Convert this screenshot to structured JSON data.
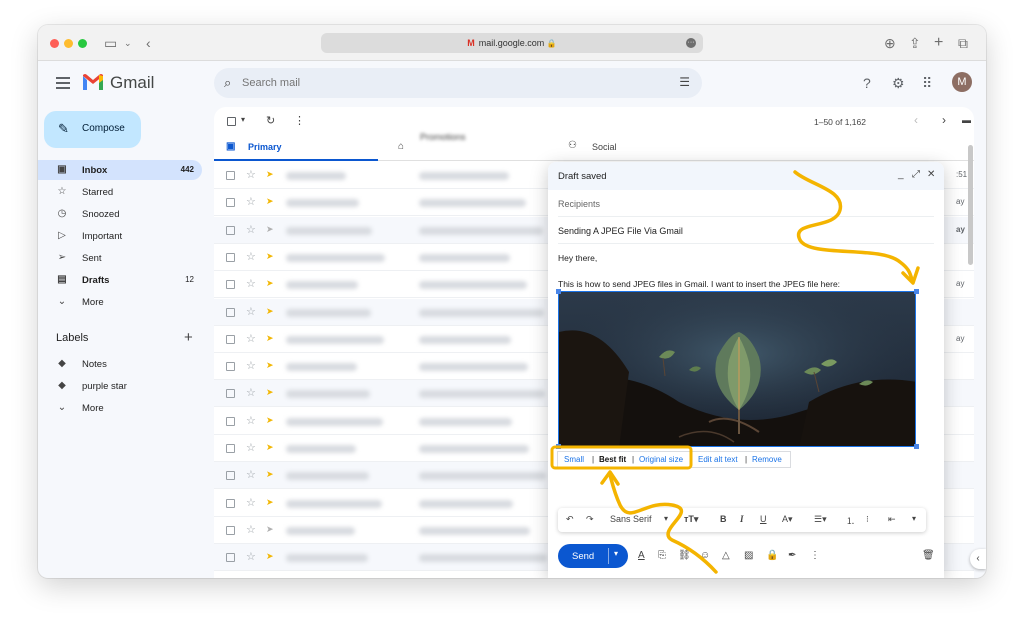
{
  "browser": {
    "url": "mail.google.com"
  },
  "gmail": {
    "brand": "Gmail",
    "search_placeholder": "Search mail",
    "avatar_letter": "M"
  },
  "sidebar": {
    "compose_label": "Compose",
    "items": [
      {
        "label": "Inbox",
        "count": "442",
        "icon": "inbox-icon"
      },
      {
        "label": "Starred",
        "count": "",
        "icon": "star-icon"
      },
      {
        "label": "Snoozed",
        "count": "",
        "icon": "clock-icon"
      },
      {
        "label": "Important",
        "count": "",
        "icon": "important-icon"
      },
      {
        "label": "Sent",
        "count": "",
        "icon": "send-icon"
      },
      {
        "label": "Drafts",
        "count": "12",
        "icon": "draft-icon"
      },
      {
        "label": "More",
        "count": "",
        "icon": "chevron-down-icon"
      }
    ],
    "labels_heading": "Labels",
    "labels": [
      {
        "label": "Notes",
        "icon": "label-icon"
      },
      {
        "label": "purple star",
        "icon": "label-icon"
      },
      {
        "label": "More",
        "icon": "chevron-down-icon"
      }
    ]
  },
  "toolbar": {
    "pagination": "1–50 of 1,162"
  },
  "tabs": {
    "primary": "Primary",
    "promotions": "Promotions",
    "social": "Social"
  },
  "list_edge": {
    "row1": ":51",
    "row2": "ay",
    "row3": "ay",
    "row4": "ay",
    "row5": "ay"
  },
  "compose_window": {
    "title": "Draft saved",
    "recipients_placeholder": "Recipients",
    "subject": "Sending A JPEG File Via Gmail",
    "greeting": "Hey there,",
    "body": "This is how to send JPEG files in Gmail. I want to insert the JPEG file here:",
    "image_options": {
      "small": "Small",
      "best_fit": "Best fit",
      "original_size": "Original size",
      "edit_alt_text": "Edit alt text",
      "remove": "Remove"
    },
    "font_name": "Sans Serif",
    "send_label": "Send"
  },
  "colors": {
    "accent_blue": "#0b57d0",
    "compose_bg": "#c2e7ff",
    "active_nav_bg": "#d3e3fd",
    "annotation_yellow": "#f4b400"
  }
}
